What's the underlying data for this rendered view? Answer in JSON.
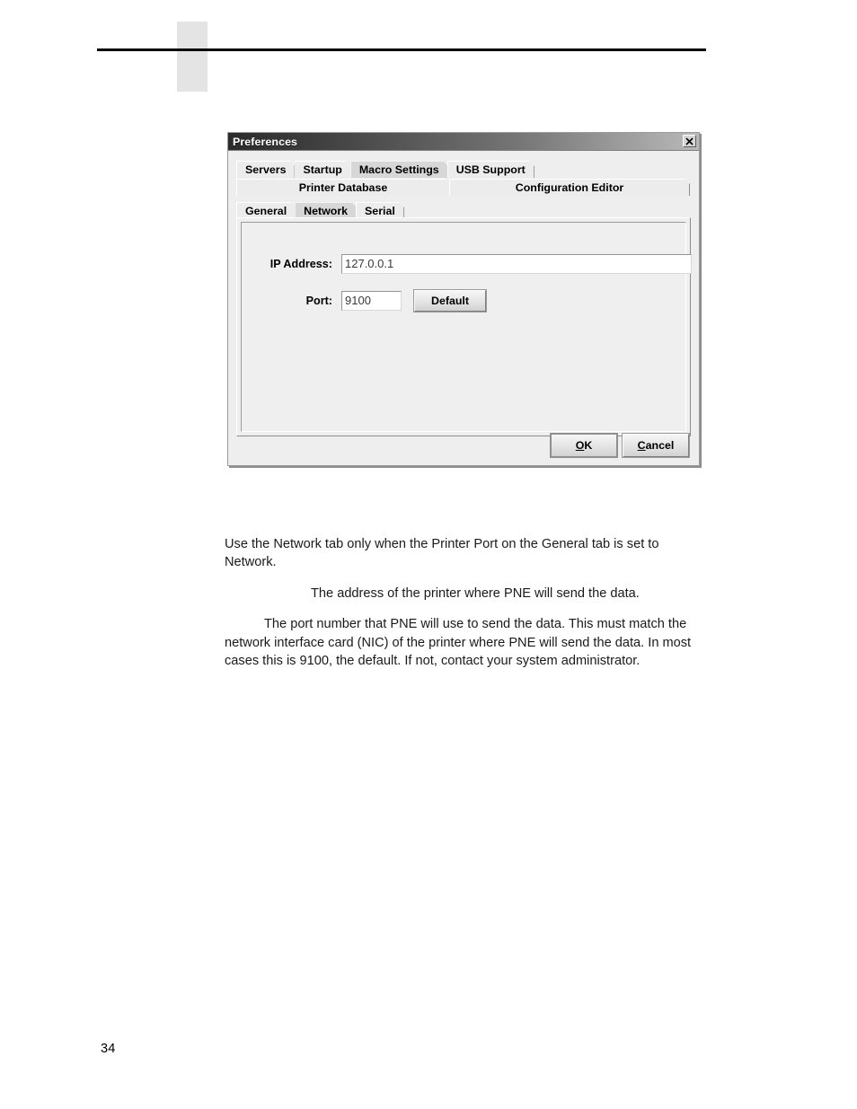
{
  "page": {
    "number": "34"
  },
  "dialog": {
    "title": "Preferences",
    "close_icon": "close-x-icon",
    "tab_rows": [
      {
        "tabs": [
          {
            "label": "Servers",
            "selected": false
          },
          {
            "label": "Startup",
            "selected": false
          },
          {
            "label": "Macro Settings",
            "selected": true
          },
          {
            "label": "USB Support",
            "selected": false
          }
        ]
      },
      {
        "tabs": [
          {
            "label": "Printer Database",
            "selected": false
          },
          {
            "label": "Configuration Editor",
            "selected": false
          }
        ]
      },
      {
        "tabs": [
          {
            "label": "General",
            "selected": false
          },
          {
            "label": "Network",
            "selected": true
          },
          {
            "label": "Serial",
            "selected": false
          }
        ]
      }
    ],
    "form": {
      "ip_address": {
        "label": "IP Address:",
        "value": "127.0.0.1",
        "placeholder": ""
      },
      "port": {
        "label": "Port:",
        "value": "9100",
        "placeholder": ""
      },
      "default_button": "Default"
    },
    "footer": {
      "ok": "OK",
      "ok_mnemonic": "O",
      "ok_rest": "K",
      "cancel": "Cancel",
      "cancel_mnemonic": "C",
      "cancel_rest": "ancel"
    }
  },
  "body_text": {
    "para1": "Use the Network tab only when the Printer Port on the General tab is set to Network.",
    "para2": "The address of the printer where PNE will send the data.",
    "para3": "The port number that PNE will use to send the data. This must match the network interface card (NIC) of the printer where PNE will send the data. In most cases this is 9100, the default. If not, contact your system administrator."
  },
  "colors": {
    "dialog_face": "#eeeeee",
    "titlebar_dark": "#2b2b2b",
    "selected_tab": "#d7d7d7",
    "field_background": "#ffffff",
    "rule": "#000000",
    "header_box": "#e4e4e4"
  }
}
